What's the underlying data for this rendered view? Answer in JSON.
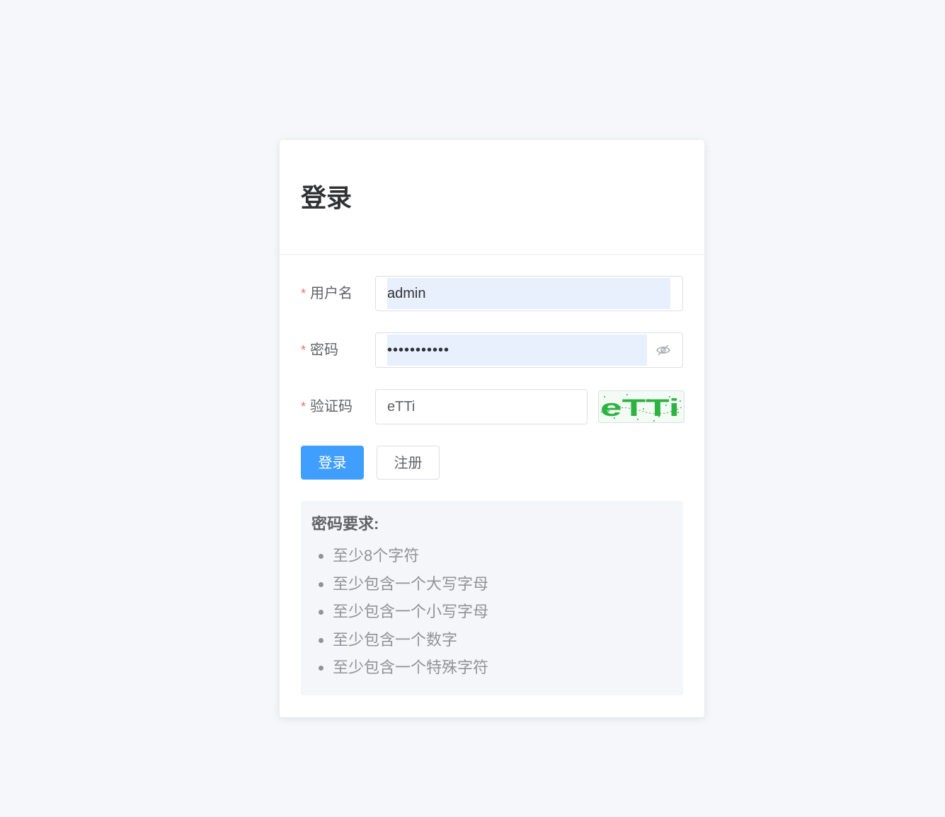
{
  "login": {
    "title": "登录",
    "fields": {
      "username": {
        "label": "用户名",
        "value": "admin"
      },
      "password": {
        "label": "密码",
        "value": "•••••••••••"
      },
      "captcha": {
        "label": "验证码",
        "value": "eTTi",
        "image_text": "eTTi"
      }
    },
    "buttons": {
      "login": "登录",
      "register": "注册"
    },
    "requirements": {
      "title": "密码要求:",
      "items": [
        "至少8个字符",
        "至少包含一个大写字母",
        "至少包含一个小写字母",
        "至少包含一个数字",
        "至少包含一个特殊字符"
      ]
    }
  },
  "colors": {
    "primary": "#409eff",
    "required_star": "#f56c6c",
    "autofill": "#e8f0fe",
    "captcha_text": "#2db342",
    "background": "#f5f7fa"
  },
  "icons": {
    "password_toggle": "eye-off-icon"
  }
}
